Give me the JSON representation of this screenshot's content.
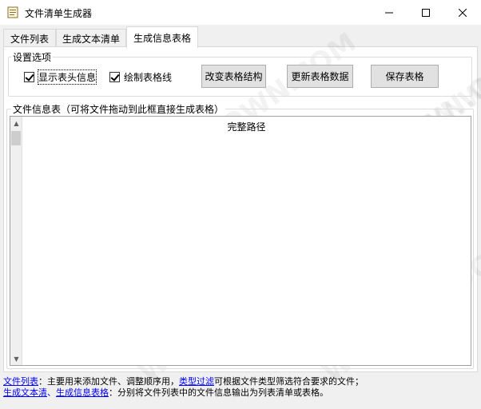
{
  "window": {
    "title": "文件清单生成器",
    "min_label": "—",
    "max_label": "☐",
    "close_label": "✕"
  },
  "tabs": [
    {
      "label": "文件列表",
      "active": false
    },
    {
      "label": "生成文本清单",
      "active": false
    },
    {
      "label": "生成信息表格",
      "active": true
    }
  ],
  "settings": {
    "group_label": "设置选项",
    "show_header": {
      "label": "显示表头信息",
      "checked": true
    },
    "draw_grid": {
      "label": "绘制表格线",
      "checked": true
    },
    "change_structure_button": "改变表格结构",
    "update_data_button": "更新表格数据",
    "save_table_button": "保存表格"
  },
  "info_table": {
    "group_label": "文件信息表（可将文件拖动到此框直接生成表格）",
    "columns": [
      "完整路径"
    ]
  },
  "help": {
    "line1": {
      "link1": "文件列表",
      "text1": "：主要用来添加文件、调整顺序用，",
      "link2": "类型过滤",
      "text2": "可根据文件类型筛选符合要求的文件；"
    },
    "line2": {
      "link1": "生成文本清",
      "sep": "、",
      "link2": "生成信息表格",
      "text1": "：分别将文件列表中的文件信息输出为列表清单或表格。"
    }
  },
  "watermark_text": "WWW.WEIDOWN.COM",
  "colors": {
    "link": "#0000ff",
    "window_bg": "#f0f0f0",
    "button_bg": "#e1e1e1"
  }
}
